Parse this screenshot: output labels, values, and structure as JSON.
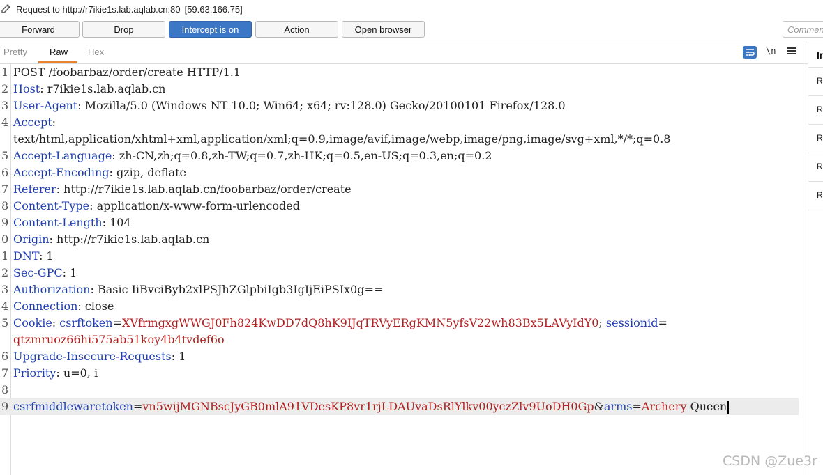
{
  "info_bar": {
    "request_label": "Request to http://r7ikie1s.lab.aqlab.cn:80",
    "ip": "[59.63.166.75]",
    "icon": "pencil-icon"
  },
  "toolbar": {
    "forward": "Forward",
    "drop": "Drop",
    "intercept": "Intercept is on",
    "action": "Action",
    "open_browser": "Open browser",
    "comment_placeholder": "Comment"
  },
  "tabs": {
    "pretty": "Pretty",
    "raw": "Raw",
    "hex": "Hex",
    "active": "Raw",
    "newline_toggle": "\\n",
    "wrap_icon": "wrap-lines-icon",
    "menu_icon": "hamburger-menu-icon"
  },
  "editor": {
    "lines": [
      {
        "n": "1",
        "key": "POST /foobarbaz/order/create HTTP/1.1",
        "sep": "",
        "val": ""
      },
      {
        "n": "2",
        "key": "Host",
        "sep": ": ",
        "val": "r7ikie1s.lab.aqlab.cn"
      },
      {
        "n": "3",
        "key": "User-Agent",
        "sep": ": ",
        "val": "Mozilla/5.0 (Windows NT 10.0; Win64; x64; rv:128.0) Gecko/20100101 Firefox/128.0"
      },
      {
        "n": "4",
        "key": "Accept",
        "sep": ":",
        "val": ""
      },
      {
        "n": "",
        "key": "",
        "sep": "",
        "val": "text/html,application/xhtml+xml,application/xml;q=0.9,image/avif,image/webp,image/png,image/svg+xml,*/*;q=0.8"
      },
      {
        "n": "5",
        "key": "Accept-Language",
        "sep": ": ",
        "val": "zh-CN,zh;q=0.8,zh-TW;q=0.7,zh-HK;q=0.5,en-US;q=0.3,en;q=0.2"
      },
      {
        "n": "6",
        "key": "Accept-Encoding",
        "sep": ": ",
        "val": "gzip, deflate"
      },
      {
        "n": "7",
        "key": "Referer",
        "sep": ": ",
        "val": "http://r7ikie1s.lab.aqlab.cn/foobarbaz/order/create"
      },
      {
        "n": "8",
        "key": "Content-Type",
        "sep": ": ",
        "val": "application/x-www-form-urlencoded"
      },
      {
        "n": "9",
        "key": "Content-Length",
        "sep": ": ",
        "val": "104"
      },
      {
        "n": "0",
        "key": "Origin",
        "sep": ": ",
        "val": "http://r7ikie1s.lab.aqlab.cn"
      },
      {
        "n": "1",
        "key": "DNT",
        "sep": ": ",
        "val": "1"
      },
      {
        "n": "2",
        "key": "Sec-GPC",
        "sep": ": ",
        "val": "1"
      },
      {
        "n": "3",
        "key": "Authorization",
        "sep": ": ",
        "val": "Basic IiBvciByb2xlPSJhZGlpbiIgb3IgIjEiPSIx0g=="
      },
      {
        "n": "4",
        "key": "Connection",
        "sep": ": ",
        "val": "close"
      }
    ],
    "cookie": {
      "n": "5",
      "key": "Cookie",
      "csrf_name": "csrftoken",
      "csrf_value": "XVfrmgxgWWGJ0Fh824KwDD7dQ8hK9IJqTRVyERgKMN5yfsV22wh83Bx5LAVyIdY0",
      "session_name": "sessionid",
      "session_value": "qtzmruoz66hi575ab51koy4b4tvdef6o"
    },
    "after_cookie": [
      {
        "n": "6",
        "key": "Upgrade-Insecure-Requests",
        "sep": ": ",
        "val": "1"
      },
      {
        "n": "7",
        "key": "Priority",
        "sep": ": ",
        "val": "u=0, i"
      }
    ],
    "blank_line_number": "8",
    "body": {
      "n": "9",
      "p1_name": "csrfmiddlewaretoken",
      "p1_value": "vn5wijMGNBscJyGB0mlA91VDesKP8vr1rjLDAUvaDsRlYlkv00yczZlv9UoDH0Gp",
      "p2_name": "arms",
      "p2_value": "Archery",
      "p2_tail": " Queen"
    }
  },
  "inspector": {
    "title": "In",
    "items": [
      "Re",
      "Re",
      "Re",
      "Re",
      "Re"
    ]
  },
  "watermark": "CSDN @Zue3r"
}
